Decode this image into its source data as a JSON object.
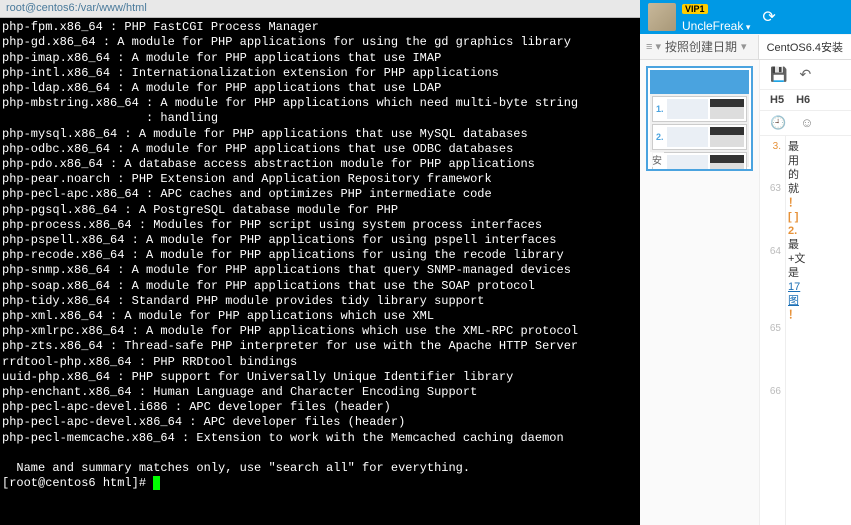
{
  "terminal": {
    "title": "root@centos6:/var/www/html",
    "lines": [
      "php-fpm.x86_64 : PHP FastCGI Process Manager",
      "php-gd.x86_64 : A module for PHP applications for using the gd graphics library",
      "php-imap.x86_64 : A module for PHP applications that use IMAP",
      "php-intl.x86_64 : Internationalization extension for PHP applications",
      "php-ldap.x86_64 : A module for PHP applications that use LDAP",
      "php-mbstring.x86_64 : A module for PHP applications which need multi-byte string",
      "                    : handling",
      "php-mysql.x86_64 : A module for PHP applications that use MySQL databases",
      "php-odbc.x86_64 : A module for PHP applications that use ODBC databases",
      "php-pdo.x86_64 : A database access abstraction module for PHP applications",
      "php-pear.noarch : PHP Extension and Application Repository framework",
      "php-pecl-apc.x86_64 : APC caches and optimizes PHP intermediate code",
      "php-pgsql.x86_64 : A PostgreSQL database module for PHP",
      "php-process.x86_64 : Modules for PHP script using system process interfaces",
      "php-pspell.x86_64 : A module for PHP applications for using pspell interfaces",
      "php-recode.x86_64 : A module for PHP applications for using the recode library",
      "php-snmp.x86_64 : A module for PHP applications that query SNMP-managed devices",
      "php-soap.x86_64 : A module for PHP applications that use the SOAP protocol",
      "php-tidy.x86_64 : Standard PHP module provides tidy library support",
      "php-xml.x86_64 : A module for PHP applications which use XML",
      "php-xmlrpc.x86_64 : A module for PHP applications which use the XML-RPC protocol",
      "php-zts.x86_64 : Thread-safe PHP interpreter for use with the Apache HTTP Server",
      "rrdtool-php.x86_64 : PHP RRDtool bindings",
      "uuid-php.x86_64 : PHP support for Universally Unique Identifier library",
      "php-enchant.x86_64 : Human Language and Character Encoding Support",
      "php-pecl-apc-devel.i686 : APC developer files (header)",
      "php-pecl-apc-devel.x86_64 : APC developer files (header)",
      "php-pecl-memcache.x86_64 : Extension to work with the Memcached caching daemon",
      "",
      "  Name and summary matches only, use \"search all\" for everything."
    ],
    "prompt": "[root@centos6 html]# "
  },
  "user": {
    "vip": "VIP1",
    "name": "UncleFreak"
  },
  "tabs": {
    "sort_label": "按照创建日期",
    "doc_title": "CentOS6.4安装"
  },
  "thumb": {
    "label": "安"
  },
  "gutter": [
    "3.",
    "63",
    "64",
    "65",
    "66"
  ],
  "lines": {
    "l1": "最",
    "l2": "用",
    "l3": "的",
    "l4": "就",
    "l5": "！",
    "l6": "[ ]",
    "l7": "2.",
    "l8": "最",
    "l9": "+文",
    "l10": "是",
    "l11": "17",
    "l12": "图",
    "l13": "！"
  },
  "format": {
    "h5": "H5",
    "h6": "H6"
  }
}
